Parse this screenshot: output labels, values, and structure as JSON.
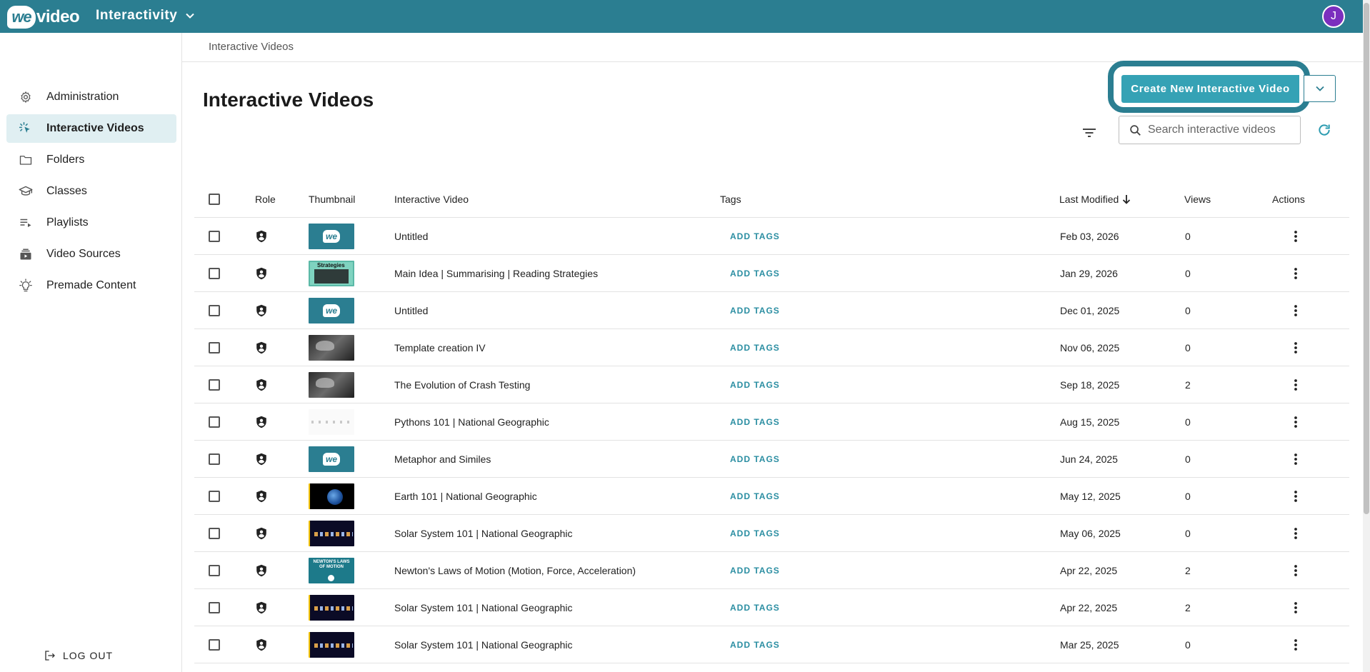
{
  "app": {
    "logo_we": "we",
    "logo_video": "video",
    "switcher_label": "Interactivity",
    "avatar_initial": "J",
    "brand_color": "#2b7e91",
    "avatar_color": "#7b2fbe"
  },
  "sidebar": {
    "items": [
      {
        "label": "Administration",
        "icon": "gear-icon"
      },
      {
        "label": "Interactive Videos",
        "icon": "click-icon",
        "active": true
      },
      {
        "label": "Folders",
        "icon": "folder-icon"
      },
      {
        "label": "Classes",
        "icon": "graduation-cap-icon"
      },
      {
        "label": "Playlists",
        "icon": "playlist-icon"
      },
      {
        "label": "Video Sources",
        "icon": "video-sources-icon"
      },
      {
        "label": "Premade Content",
        "icon": "lightbulb-icon"
      }
    ],
    "logout_label": "LOG OUT"
  },
  "breadcrumb": "Interactive Videos",
  "page_title": "Interactive Videos",
  "toolbar": {
    "create_label": "Create New Interactive Video",
    "search_placeholder": "Search interactive videos",
    "search_value": ""
  },
  "table": {
    "headers": {
      "role": "Role",
      "thumbnail": "Thumbnail",
      "title": "Interactive Video",
      "tags": "Tags",
      "modified": "Last Modified",
      "views": "Views",
      "actions": "Actions"
    },
    "add_tags_label": "ADD TAGS",
    "rows": [
      {
        "title": "Untitled",
        "date": "Feb 03, 2026",
        "views": "0",
        "thumb": "we"
      },
      {
        "title": "Main Idea | Summarising | Reading Strategies",
        "date": "Jan 29, 2026",
        "views": "0",
        "thumb": "strategies"
      },
      {
        "title": "Untitled",
        "date": "Dec 01, 2025",
        "views": "0",
        "thumb": "we"
      },
      {
        "title": "Template creation IV",
        "date": "Nov 06, 2025",
        "views": "0",
        "thumb": "dark"
      },
      {
        "title": "The Evolution of Crash Testing",
        "date": "Sep 18, 2025",
        "views": "2",
        "thumb": "dark"
      },
      {
        "title": "Pythons 101 | National Geographic",
        "date": "Aug 15, 2025",
        "views": "0",
        "thumb": "white"
      },
      {
        "title": "Metaphor and Similes",
        "date": "Jun 24, 2025",
        "views": "0",
        "thumb": "we"
      },
      {
        "title": "Earth 101 | National Geographic",
        "date": "May 12, 2025",
        "views": "0",
        "thumb": "earth"
      },
      {
        "title": "Solar System 101 | National Geographic",
        "date": "May 06, 2025",
        "views": "0",
        "thumb": "solar"
      },
      {
        "title": "Newton's Laws of Motion (Motion, Force, Acceleration)",
        "date": "Apr 22, 2025",
        "views": "2",
        "thumb": "newton"
      },
      {
        "title": "Solar System 101 | National Geographic",
        "date": "Apr 22, 2025",
        "views": "2",
        "thumb": "solar"
      },
      {
        "title": "Solar System 101 | National Geographic",
        "date": "Mar 25, 2025",
        "views": "0",
        "thumb": "solar"
      }
    ],
    "thumb_texts": {
      "we": "we",
      "strategies": "Strategies",
      "newton": "NEWTON'S LAWS OF MOTION"
    }
  }
}
